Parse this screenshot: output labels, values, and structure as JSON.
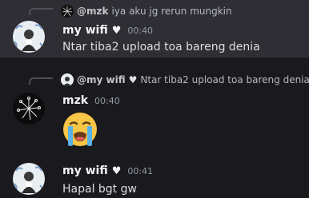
{
  "messages": [
    {
      "reply": {
        "author": "@mzk",
        "text": "iya aku jg rerun mungkin"
      },
      "author": "my wifi",
      "author_heart": "♥",
      "time": "00:40",
      "content": "Ntar tiba2 upload toa bareng denia",
      "highlighted": true
    },
    {
      "reply": {
        "author": "@my wifi",
        "author_heart": "♥",
        "text": "Ntar tiba2 upload toa bareng denia"
      },
      "author": "mzk",
      "time": "00:40",
      "content_emoji": "loudly-crying-face"
    },
    {
      "author": "my wifi",
      "author_heart": "♥",
      "time": "00:41",
      "content": "Hapal bgt gw"
    }
  ],
  "colors": {
    "background": "#1a1a1e",
    "highlight": "#2e2e34",
    "username": "#f2f3f5",
    "text": "#dbdee1",
    "timestamp": "#949ba4"
  }
}
